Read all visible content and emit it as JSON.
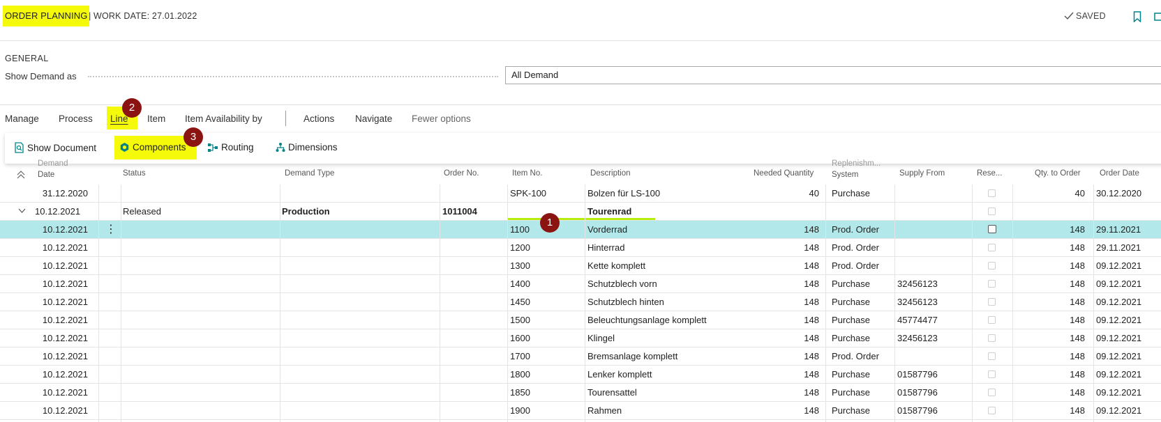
{
  "header": {
    "page_title": "ORDER PLANNING",
    "separator": "|",
    "work_date": "WORK DATE: 27.01.2022",
    "saved": "SAVED"
  },
  "general": {
    "heading": "GENERAL",
    "show_demand_label": "Show Demand as",
    "show_demand_value": "All Demand"
  },
  "menu": {
    "items": [
      "Manage",
      "Process",
      "Line",
      "Item",
      "Item Availability by",
      "Actions",
      "Navigate",
      "Fewer options"
    ]
  },
  "subbar": {
    "show_document": "Show Document",
    "components": "Components",
    "routing": "Routing",
    "dimensions": "Dimensions"
  },
  "badges": [
    "1",
    "2",
    "3"
  ],
  "table": {
    "headers": {
      "demand_date_1": "Demand",
      "demand_date_2": "Date",
      "status": "Status",
      "demand_type": "Demand Type",
      "order_no": "Order No.",
      "item_no": "Item No.",
      "description": "Description",
      "needed_quantity": "Needed Quantity",
      "replenishment_1": "Replenishm...",
      "replenishment_2": "System",
      "supply_from": "Supply From",
      "reserve": "Rese...",
      "qty_to_order": "Qty. to Order",
      "order_date": "Order Date"
    },
    "rows": [
      {
        "date": "31.12.2020",
        "status": "",
        "demand_type": "",
        "order_no": "",
        "item_no": "SPK-100",
        "description": "Bolzen für LS-100",
        "needed": "40",
        "system": "Purchase",
        "supply_from": "",
        "qty": "40",
        "order_date": "30.12.2020"
      },
      {
        "date": "10.12.2021",
        "status": "Released",
        "demand_type": "Production",
        "order_no": "1011004",
        "item_no": "",
        "description": "Tourenrad",
        "needed": "",
        "system": "",
        "supply_from": "",
        "qty": "",
        "order_date": ""
      },
      {
        "date": "10.12.2021",
        "status": "",
        "demand_type": "",
        "order_no": "",
        "item_no": "1100",
        "description": "Vorderrad",
        "needed": "148",
        "system": "Prod. Order",
        "supply_from": "",
        "qty": "148",
        "order_date": "29.11.2021"
      },
      {
        "date": "10.12.2021",
        "status": "",
        "demand_type": "",
        "order_no": "",
        "item_no": "1200",
        "description": "Hinterrad",
        "needed": "148",
        "system": "Prod. Order",
        "supply_from": "",
        "qty": "148",
        "order_date": "29.11.2021"
      },
      {
        "date": "10.12.2021",
        "status": "",
        "demand_type": "",
        "order_no": "",
        "item_no": "1300",
        "description": "Kette komplett",
        "needed": "148",
        "system": "Prod. Order",
        "supply_from": "",
        "qty": "148",
        "order_date": "09.12.2021"
      },
      {
        "date": "10.12.2021",
        "status": "",
        "demand_type": "",
        "order_no": "",
        "item_no": "1400",
        "description": "Schutzblech vorn",
        "needed": "148",
        "system": "Purchase",
        "supply_from": "32456123",
        "qty": "148",
        "order_date": "09.12.2021"
      },
      {
        "date": "10.12.2021",
        "status": "",
        "demand_type": "",
        "order_no": "",
        "item_no": "1450",
        "description": "Schutzblech hinten",
        "needed": "148",
        "system": "Purchase",
        "supply_from": "32456123",
        "qty": "148",
        "order_date": "09.12.2021"
      },
      {
        "date": "10.12.2021",
        "status": "",
        "demand_type": "",
        "order_no": "",
        "item_no": "1500",
        "description": "Beleuchtungsanlage komplett",
        "needed": "148",
        "system": "Purchase",
        "supply_from": "45774477",
        "qty": "148",
        "order_date": "09.12.2021"
      },
      {
        "date": "10.12.2021",
        "status": "",
        "demand_type": "",
        "order_no": "",
        "item_no": "1600",
        "description": "Klingel",
        "needed": "148",
        "system": "Purchase",
        "supply_from": "32456123",
        "qty": "148",
        "order_date": "09.12.2021"
      },
      {
        "date": "10.12.2021",
        "status": "",
        "demand_type": "",
        "order_no": "",
        "item_no": "1700",
        "description": "Bremsanlage komplett",
        "needed": "148",
        "system": "Prod. Order",
        "supply_from": "",
        "qty": "148",
        "order_date": "09.12.2021"
      },
      {
        "date": "10.12.2021",
        "status": "",
        "demand_type": "",
        "order_no": "",
        "item_no": "1800",
        "description": "Lenker komplett",
        "needed": "148",
        "system": "Purchase",
        "supply_from": "01587796",
        "qty": "148",
        "order_date": "09.12.2021"
      },
      {
        "date": "10.12.2021",
        "status": "",
        "demand_type": "",
        "order_no": "",
        "item_no": "1850",
        "description": "Tourensattel",
        "needed": "148",
        "system": "Purchase",
        "supply_from": "01587796",
        "qty": "148",
        "order_date": "09.12.2021"
      },
      {
        "date": "10.12.2021",
        "status": "",
        "demand_type": "",
        "order_no": "",
        "item_no": "1900",
        "description": "Rahmen",
        "needed": "148",
        "system": "Purchase",
        "supply_from": "01587796",
        "qty": "148",
        "order_date": "09.12.2021"
      }
    ]
  },
  "colors": {
    "highlight_yellow": "#f5fa0a",
    "highlight_green": "#b6ec0e",
    "selected_row": "#b2e8ea",
    "badge": "#8b1413",
    "icon_teal": "#008489"
  }
}
